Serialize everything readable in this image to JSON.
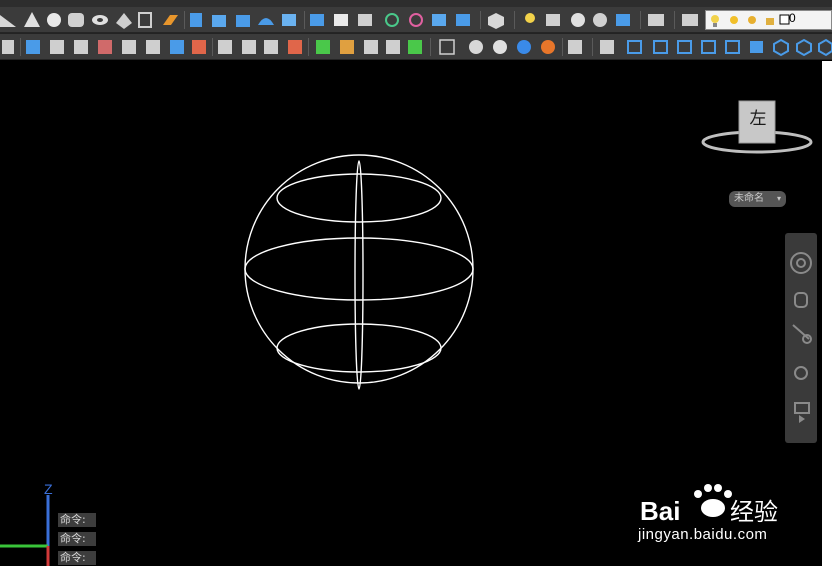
{
  "toolbar_top": {
    "layer_name": "0"
  },
  "viewcube": {
    "face_label": "左"
  },
  "named_view": {
    "label": "未命名"
  },
  "ucs": {
    "z_label": "Z"
  },
  "command_lines": [
    "命令:",
    "命令:",
    "命令:"
  ],
  "watermark": {
    "logo": "Bai du 经验",
    "url": "jingyan.baidu.com"
  },
  "colors": {
    "toolbar_bg": "#3b3b3b",
    "canvas_bg": "#000000",
    "wire_color": "#ffffff",
    "ucs_z": "#3a6fd8",
    "ucs_x": "#d23a3a",
    "ucs_y": "#3ac43a"
  }
}
